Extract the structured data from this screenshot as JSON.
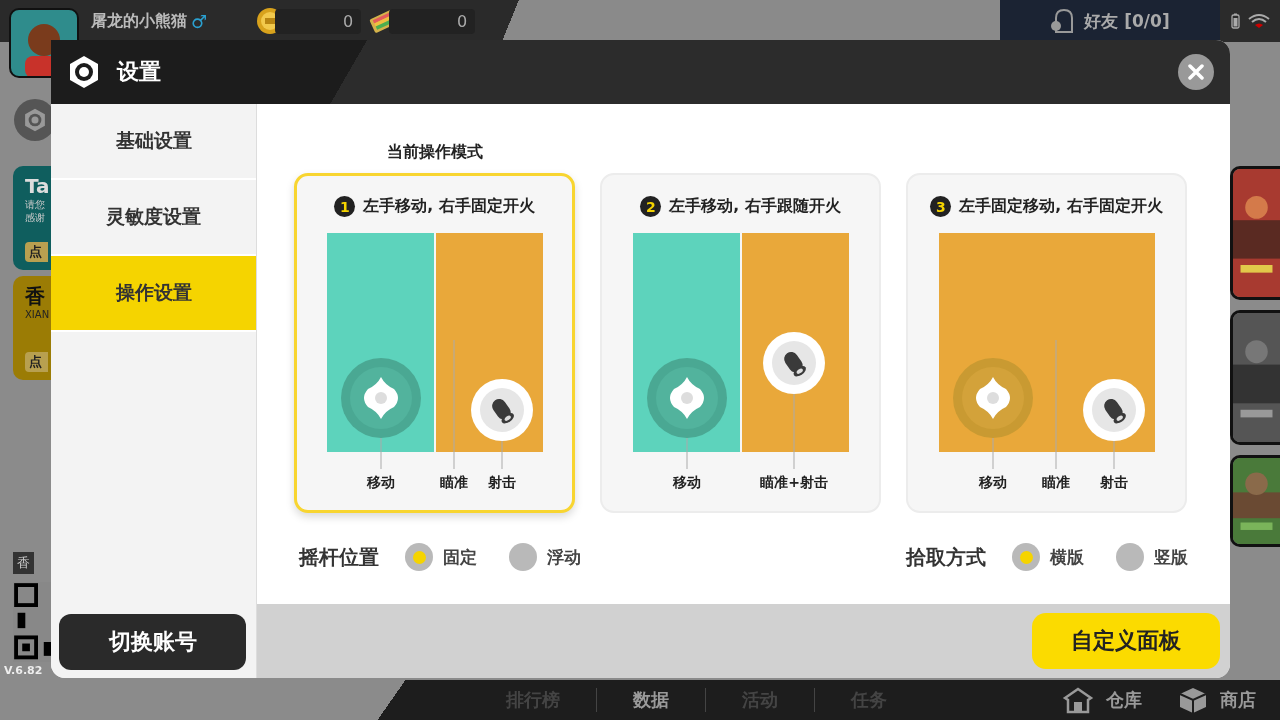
{
  "player": {
    "name": "屠龙的小熊猫",
    "gender": "♂"
  },
  "currencies": [
    {
      "kind": "coin",
      "amount": "0"
    },
    {
      "kind": "ticket",
      "amount": "0"
    }
  ],
  "friends": {
    "label": "好友 [0/0]"
  },
  "promo_cards": [
    {
      "kind": "teal",
      "title": "Ta",
      "lines": [
        "请您",
        "感谢"
      ],
      "button": "点"
    },
    {
      "kind": "gold",
      "title": "香",
      "lines": [
        "XIAN"
      ],
      "button": "点"
    }
  ],
  "qr_label": "香",
  "version": "V.6.82",
  "nav": [
    {
      "label": "排行榜",
      "selected": false
    },
    {
      "label": "数据",
      "selected": true
    },
    {
      "label": "活动",
      "selected": false
    },
    {
      "label": "任务",
      "selected": false
    }
  ],
  "shortcuts": [
    {
      "kind": "warehouse",
      "label": "仓库"
    },
    {
      "kind": "shop",
      "label": "商店"
    }
  ],
  "dialog": {
    "title": "设置",
    "menu": [
      {
        "label": "基础设置",
        "selected": false
      },
      {
        "label": "灵敏度设置",
        "selected": false
      },
      {
        "label": "操作设置",
        "selected": true
      }
    ],
    "switch_account": "切换账号",
    "current_mode_heading": "当前操作模式",
    "modes": [
      {
        "number": "1",
        "title": "左手移动, 右手固定开火",
        "selected": true,
        "kind": "split_fixed",
        "labels": [
          {
            "kind": "move",
            "text": "移动"
          },
          {
            "kind": "aim",
            "text": "瞄准"
          },
          {
            "kind": "fire",
            "text": "射击"
          }
        ]
      },
      {
        "number": "2",
        "title": "左手移动, 右手跟随开火",
        "selected": false,
        "kind": "split_follow",
        "labels": [
          {
            "kind": "move",
            "text": "移动"
          },
          {
            "kind": "aim_fire",
            "text": "瞄准+射击"
          }
        ]
      },
      {
        "number": "3",
        "title": "左手固定移动, 右手固定开火",
        "selected": false,
        "kind": "full_fixed",
        "labels": [
          {
            "kind": "move",
            "text": "移动"
          },
          {
            "kind": "aim",
            "text": "瞄准"
          },
          {
            "kind": "fire",
            "text": "射击"
          }
        ]
      }
    ],
    "options": [
      {
        "label": "摇杆位置",
        "choices": [
          {
            "label": "固定",
            "selected": true
          },
          {
            "label": "浮动",
            "selected": false
          }
        ]
      },
      {
        "label": "拾取方式",
        "choices": [
          {
            "label": "横版",
            "selected": true
          },
          {
            "label": "竖版",
            "selected": false
          }
        ]
      }
    ],
    "custom_panel": "自定义面板"
  }
}
